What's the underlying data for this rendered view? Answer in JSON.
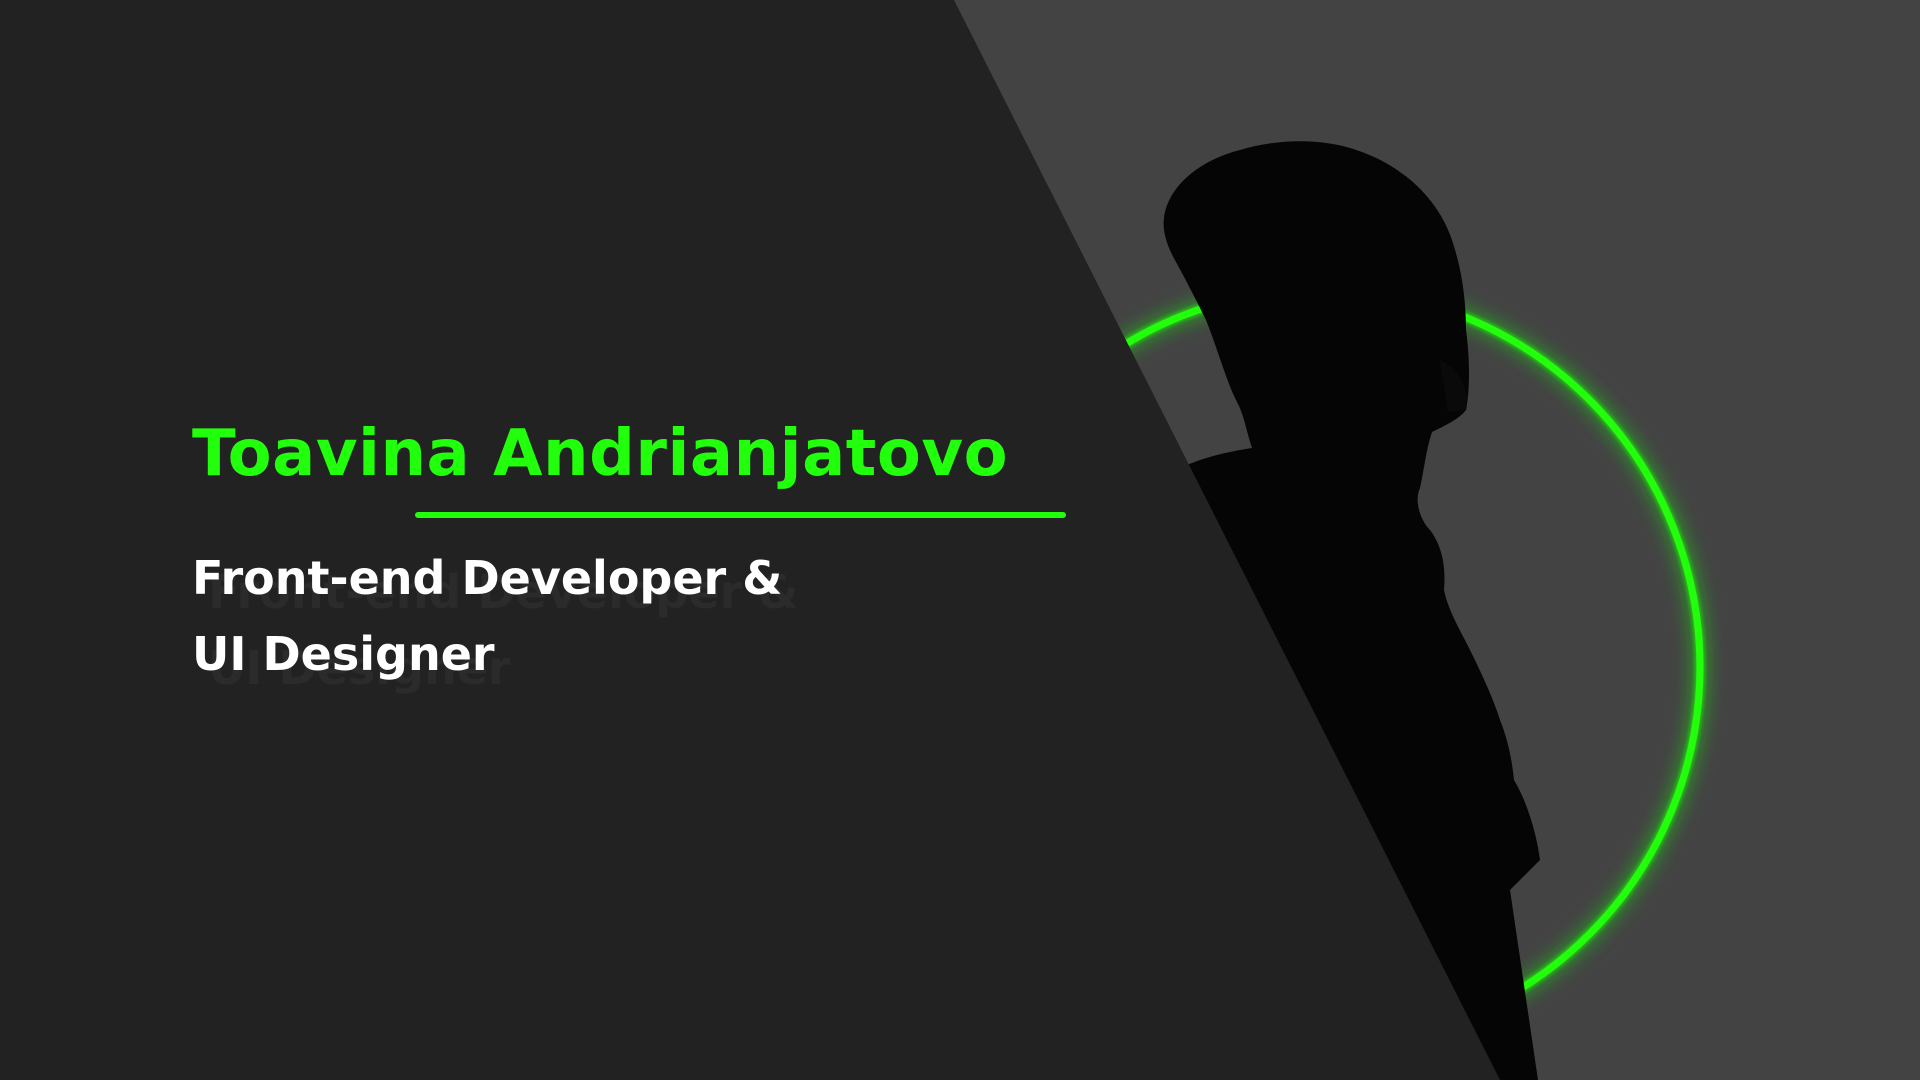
{
  "hero": {
    "name": "Toavina Andrianjatovo",
    "role_line_1": "Front-end Developer &",
    "role_line_2": "UI Designer"
  },
  "graphics": {
    "portrait": "portrait-silhouette",
    "ring": "neon-ring",
    "panel": "diagonal-dark-panel"
  },
  "colors": {
    "accent": "#22ff0c",
    "dark_panel": "#222222",
    "right_bg": "#434343",
    "silhouette": "#050505",
    "role_text": "#ffffff"
  }
}
